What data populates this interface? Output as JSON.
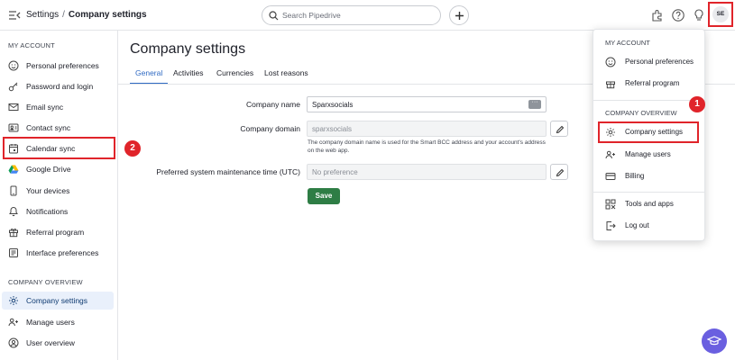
{
  "header": {
    "breadcrumb_root": "Settings",
    "breadcrumb_sep": "/",
    "breadcrumb_current": "Company settings",
    "search_placeholder": "Search Pipedrive",
    "avatar_initials": "SE"
  },
  "sidebar": {
    "section_my_account": "MY ACCOUNT",
    "section_company": "COMPANY OVERVIEW",
    "items": [
      {
        "label": "Personal preferences",
        "icon": "face-icon"
      },
      {
        "label": "Password and login",
        "icon": "key-icon"
      },
      {
        "label": "Email sync",
        "icon": "mail-icon"
      },
      {
        "label": "Contact sync",
        "icon": "contact-card-icon"
      },
      {
        "label": "Calendar sync",
        "icon": "calendar-icon"
      },
      {
        "label": "Google Drive",
        "icon": "google-drive-icon"
      },
      {
        "label": "Your devices",
        "icon": "phone-icon"
      },
      {
        "label": "Notifications",
        "icon": "bell-icon"
      },
      {
        "label": "Referral program",
        "icon": "gift-icon"
      },
      {
        "label": "Interface preferences",
        "icon": "sliders-icon"
      }
    ],
    "company_items": [
      {
        "label": "Company settings",
        "icon": "gear-icon",
        "active": true
      },
      {
        "label": "Manage users",
        "icon": "users-icon"
      },
      {
        "label": "User overview",
        "icon": "user-circle-icon"
      }
    ]
  },
  "main": {
    "title": "Company settings",
    "tabs": [
      "General",
      "Activities",
      "Currencies",
      "Lost reasons"
    ],
    "active_tab": "General",
    "fields": {
      "company_name_label": "Company name",
      "company_name_value": "Sparxsocials",
      "company_domain_label": "Company domain",
      "company_domain_value": "sparxsocials",
      "domain_help": "The company domain name is used for the Smart BCC address and your account's address on the web app.",
      "maintenance_label": "Preferred system maintenance time (UTC)",
      "maintenance_value": "No preference"
    },
    "save_label": "Save"
  },
  "dropdown": {
    "section_my_account": "MY ACCOUNT",
    "section_company": "COMPANY OVERVIEW",
    "my_account_items": [
      {
        "label": "Personal preferences",
        "icon": "face-icon"
      },
      {
        "label": "Referral program",
        "icon": "gift-icon"
      }
    ],
    "company_items": [
      {
        "label": "Company settings",
        "icon": "gear-icon"
      },
      {
        "label": "Manage users",
        "icon": "users-icon"
      },
      {
        "label": "Billing",
        "icon": "credit-card-icon"
      }
    ],
    "other_items": [
      {
        "label": "Tools and apps",
        "icon": "tools-icon"
      },
      {
        "label": "Log out",
        "icon": "logout-icon"
      }
    ]
  },
  "annotations": {
    "badge_1": "1",
    "badge_2": "2",
    "highlight_color": "#e0242a"
  },
  "colors": {
    "accent": "#2f6ac3",
    "save": "#2e7d45",
    "active_bg": "#e9f0fb"
  }
}
